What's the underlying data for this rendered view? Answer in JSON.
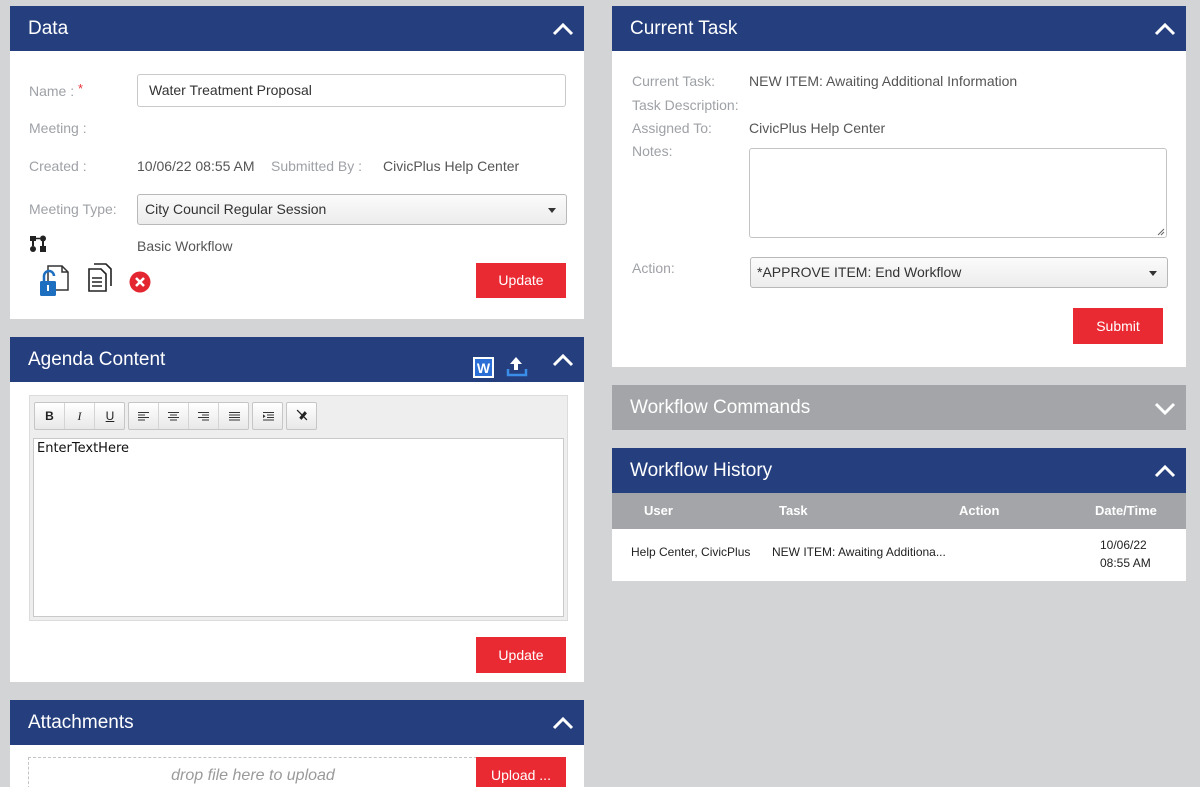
{
  "data_panel": {
    "title": "Data",
    "name_label": "Name :",
    "required_mark": "*",
    "name_value": "Water Treatment Proposal",
    "meeting_label": "Meeting :",
    "created_label": "Created :",
    "created_value": "10/06/22 08:55 AM",
    "submitted_by_label": "Submitted By :",
    "submitted_by_value": "CivicPlus Help Center",
    "meeting_type_label": "Meeting Type:",
    "meeting_type_value": "City Council Regular Session",
    "workflow_value": "Basic Workflow",
    "update_label": "Update"
  },
  "agenda_panel": {
    "title": "Agenda Content",
    "toolbar": {
      "bold": "B",
      "italic": "I",
      "underline": "U"
    },
    "editor_text": "EnterTextHere",
    "update_label": "Update"
  },
  "attachments_panel": {
    "title": "Attachments",
    "drop_text": "drop file here to upload",
    "upload_label": "Upload ..."
  },
  "current_task_panel": {
    "title": "Current Task",
    "current_task_label": "Current Task:",
    "current_task_value": "NEW ITEM: Awaiting Additional Information",
    "task_description_label": "Task Description:",
    "assigned_to_label": "Assigned To:",
    "assigned_to_value": "CivicPlus Help Center",
    "notes_label": "Notes:",
    "notes_value": "",
    "action_label": "Action:",
    "action_value": "*APPROVE ITEM: End Workflow",
    "submit_label": "Submit"
  },
  "workflow_commands_panel": {
    "title": "Workflow Commands"
  },
  "workflow_history_panel": {
    "title": "Workflow History",
    "columns": [
      "User",
      "Task",
      "Action",
      "Date/Time"
    ],
    "rows": [
      {
        "user": "Help Center, CivicPlus",
        "task": "NEW ITEM: Awaiting Additiona...",
        "action": "",
        "date": "10/06/22",
        "time": "08:55 AM"
      }
    ]
  },
  "colors": {
    "header_blue": "#253f7e",
    "header_gray": "#a3a5a8",
    "button_red": "#ea2a33",
    "page_bg": "#d3d4d6"
  }
}
